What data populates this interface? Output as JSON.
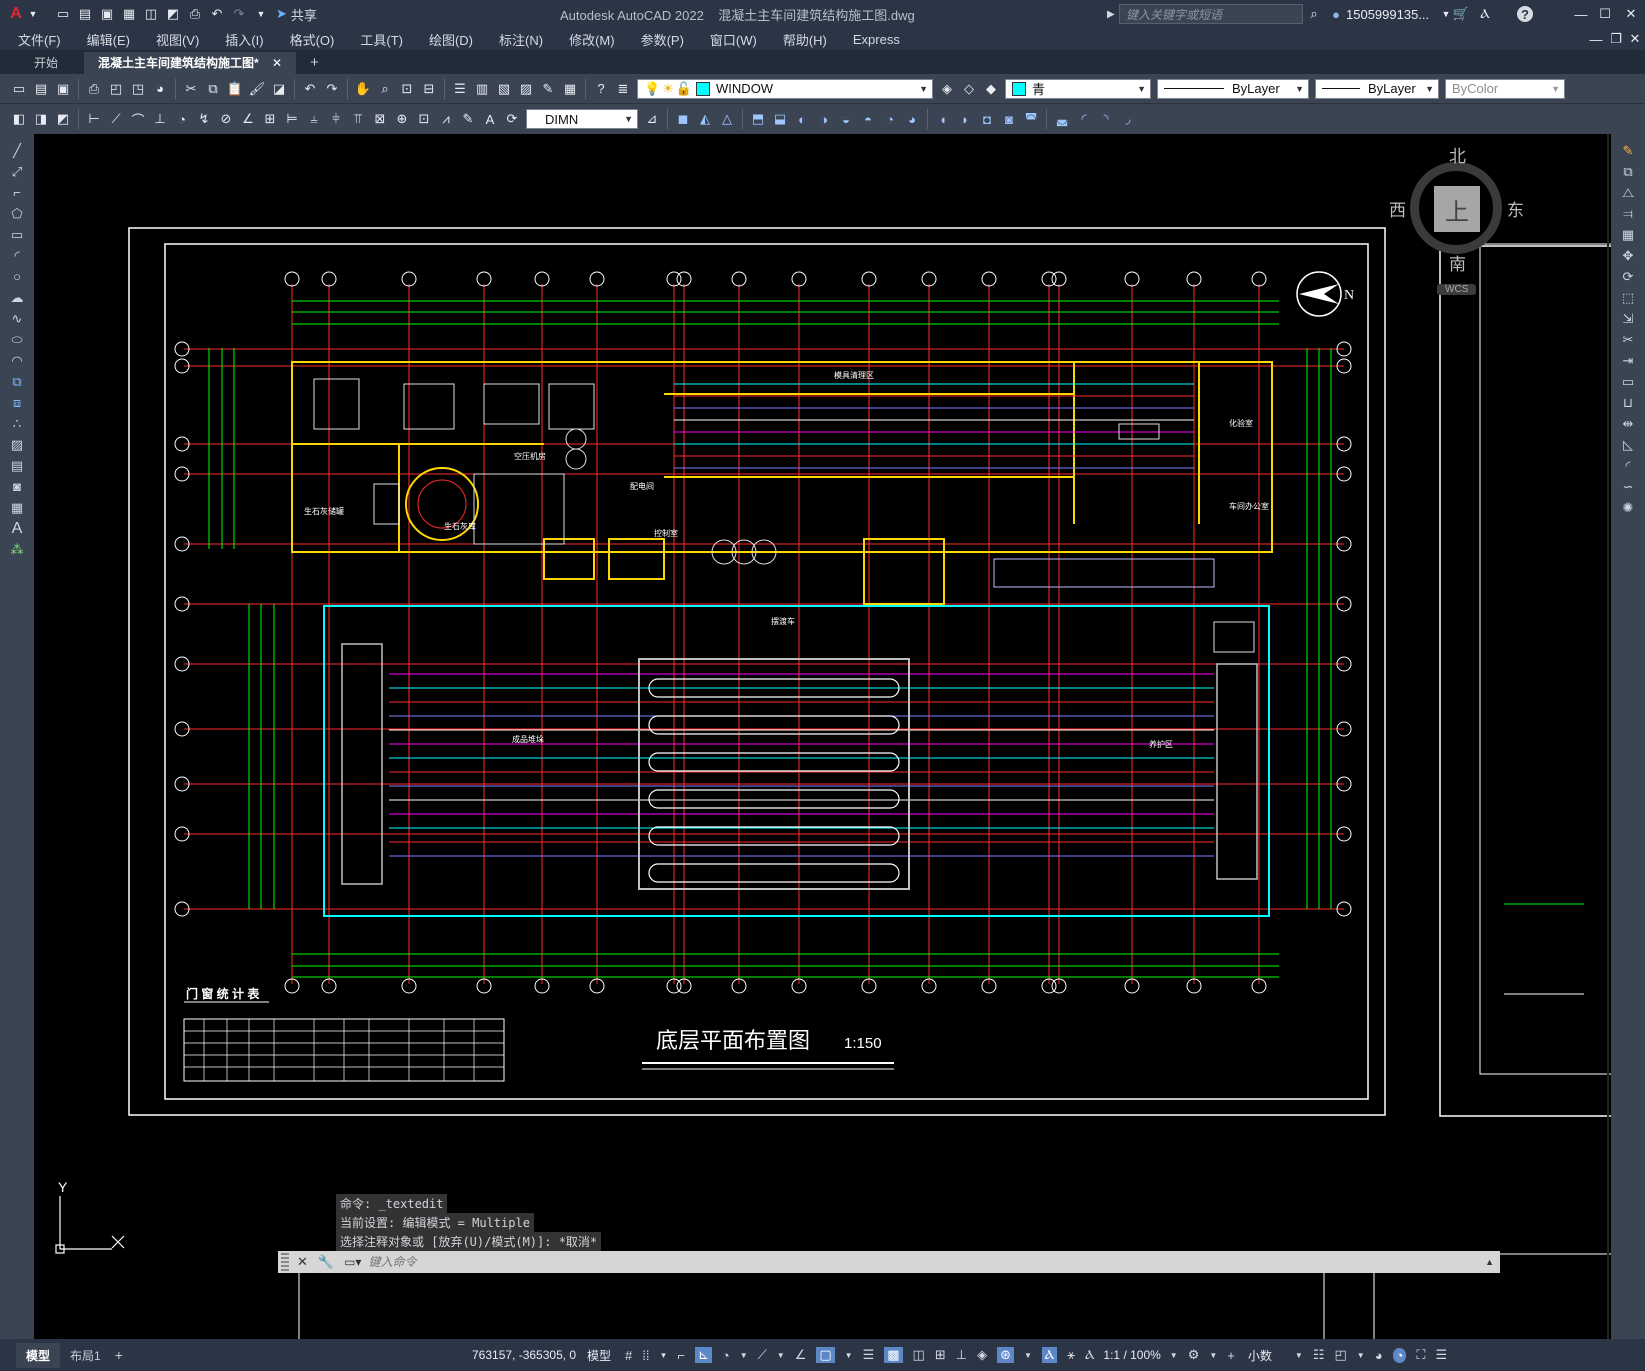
{
  "app": {
    "title": "Autodesk AutoCAD 2022",
    "document": "混凝土主车间建筑结构施工图.dwg",
    "search_placeholder": "键入关键字或短语",
    "user": "1505999135...",
    "share_label": "共享"
  },
  "menu": [
    "文件(F)",
    "编辑(E)",
    "视图(V)",
    "插入(I)",
    "格式(O)",
    "工具(T)",
    "绘图(D)",
    "标注(N)",
    "修改(M)",
    "参数(P)",
    "窗口(W)",
    "帮助(H)",
    "Express"
  ],
  "tabs": {
    "start": "开始",
    "active": "混凝土主车间建筑结构施工图*",
    "new": "+"
  },
  "toolbar": {
    "layer": "WINDOW",
    "color": "青",
    "linetype": "ByLayer",
    "lineweight": "ByLayer",
    "plotstyle": "ByColor",
    "dimstyle": "DIMN"
  },
  "viewcube": {
    "north": "北",
    "south": "南",
    "east": "东",
    "west": "西",
    "top": "上",
    "wcs": "WCS"
  },
  "drawing": {
    "title": "底层平面布置图",
    "scale": "1:150",
    "table_title": "门 窗 统 计 表",
    "north_label": "N",
    "room_labels": [
      "生石灰储罐",
      "生石灰库",
      "空压机房",
      "配电间",
      "控制室",
      "化验室",
      "车间办公室",
      "成品堆垛",
      "养护区",
      "摆渡车",
      "模具清理区"
    ],
    "colors": {
      "background": "#000000",
      "frame": "#ffffff",
      "axis": "#ff2a2a",
      "dim": "#00ff00",
      "wall": "#ffd700",
      "cyan": "#00ffff",
      "magenta": "#ff00ff"
    }
  },
  "command": {
    "history": [
      "命令: _textedit",
      "当前设置: 编辑模式 = Multiple",
      "选择注释对象或 [放弃(U)/模式(M)]: *取消*"
    ],
    "placeholder": "键入命令"
  },
  "ucs": {
    "y": "Y"
  },
  "status": {
    "tab_model": "模型",
    "tab_layout": "布局1",
    "coords": "763157, -365305, 0",
    "space": "模型",
    "scale": "1:1 / 100%",
    "units": "小数"
  }
}
